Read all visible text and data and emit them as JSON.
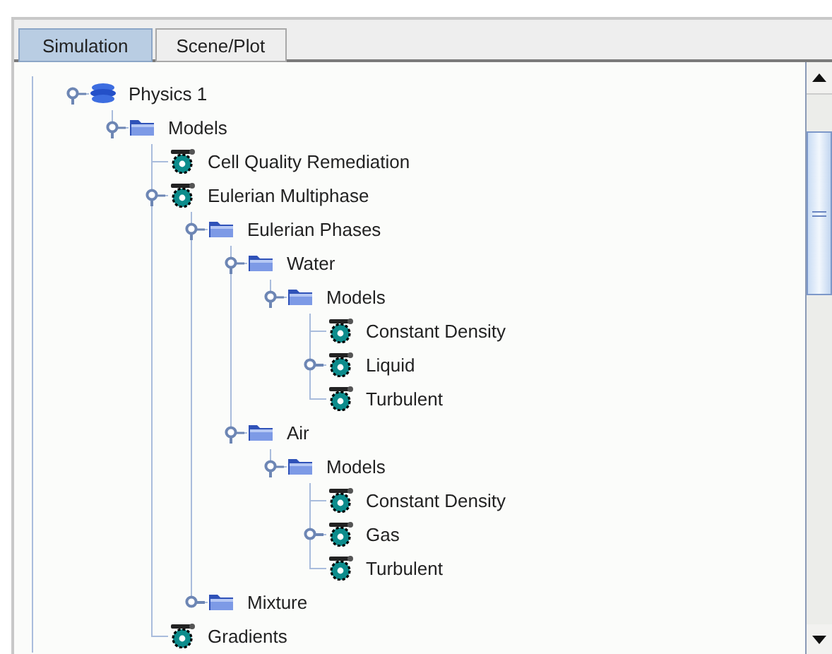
{
  "tabs": [
    {
      "label": "Simulation",
      "selected": true
    },
    {
      "label": "Scene/Plot",
      "selected": false
    }
  ],
  "tree": [
    {
      "label": "Physics 1",
      "kind": "physics",
      "expanded": true,
      "children": [
        {
          "label": "Models",
          "kind": "folder",
          "expanded": true,
          "children": [
            {
              "label": "Cell Quality Remediation",
              "kind": "model"
            },
            {
              "label": "Eulerian Multiphase",
              "kind": "model",
              "expanded": true,
              "children": [
                {
                  "label": "Eulerian Phases",
                  "kind": "folder",
                  "expanded": true,
                  "children": [
                    {
                      "label": "Water",
                      "kind": "folder",
                      "expanded": true,
                      "children": [
                        {
                          "label": "Models",
                          "kind": "folder",
                          "expanded": true,
                          "children": [
                            {
                              "label": "Constant Density",
                              "kind": "model"
                            },
                            {
                              "label": "Liquid",
                              "kind": "model",
                              "expanded": false
                            },
                            {
                              "label": "Turbulent",
                              "kind": "model"
                            }
                          ]
                        }
                      ]
                    },
                    {
                      "label": "Air",
                      "kind": "folder",
                      "expanded": true,
                      "children": [
                        {
                          "label": "Models",
                          "kind": "folder",
                          "expanded": true,
                          "children": [
                            {
                              "label": "Constant Density",
                              "kind": "model"
                            },
                            {
                              "label": "Gas",
                              "kind": "model",
                              "expanded": false
                            },
                            {
                              "label": "Turbulent",
                              "kind": "model"
                            }
                          ]
                        }
                      ]
                    }
                  ]
                },
                {
                  "label": "Mixture",
                  "kind": "folder",
                  "expanded": false
                }
              ]
            },
            {
              "label": "Gradients",
              "kind": "model"
            }
          ]
        }
      ]
    }
  ]
}
